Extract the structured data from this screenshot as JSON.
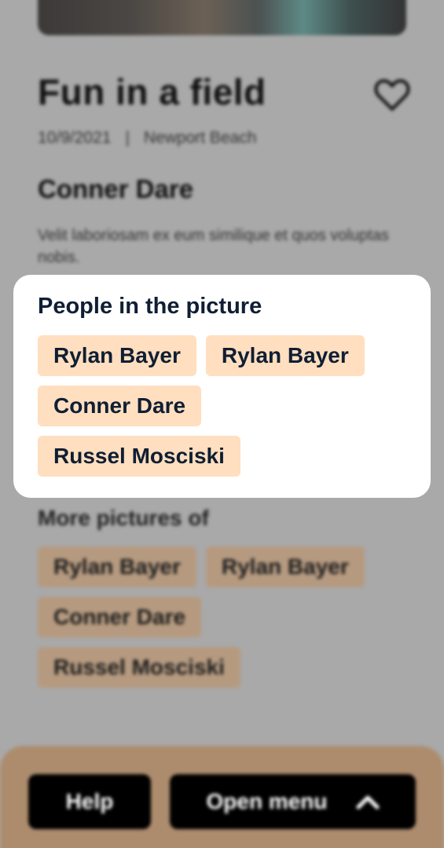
{
  "post": {
    "title": "Fun in a field",
    "date": "10/9/2021",
    "separator": "|",
    "location": "Newport Beach",
    "author": "Conner Dare",
    "description": "Velit laboriosam ex eum similique et quos voluptas nobis."
  },
  "more_pictures": {
    "heading": "More pictures of",
    "people": [
      "Rylan Bayer",
      "Rylan Bayer",
      "Conner Dare",
      "Russel Mosciski"
    ]
  },
  "modal": {
    "heading": "People in the picture",
    "people": [
      "Rylan Bayer",
      "Rylan Bayer",
      "Conner Dare",
      "Russel Mosciski"
    ]
  },
  "footer": {
    "help_label": "Help",
    "menu_label": "Open menu"
  },
  "icons": {
    "favorite": "heart-icon",
    "menu_toggle": "chevron-up-icon"
  },
  "colors": {
    "tag_background": "#ffdfbf",
    "text_dark": "#0f1e33",
    "footer_background": "#ad8c6e",
    "backdrop": "#a9a9a9"
  }
}
